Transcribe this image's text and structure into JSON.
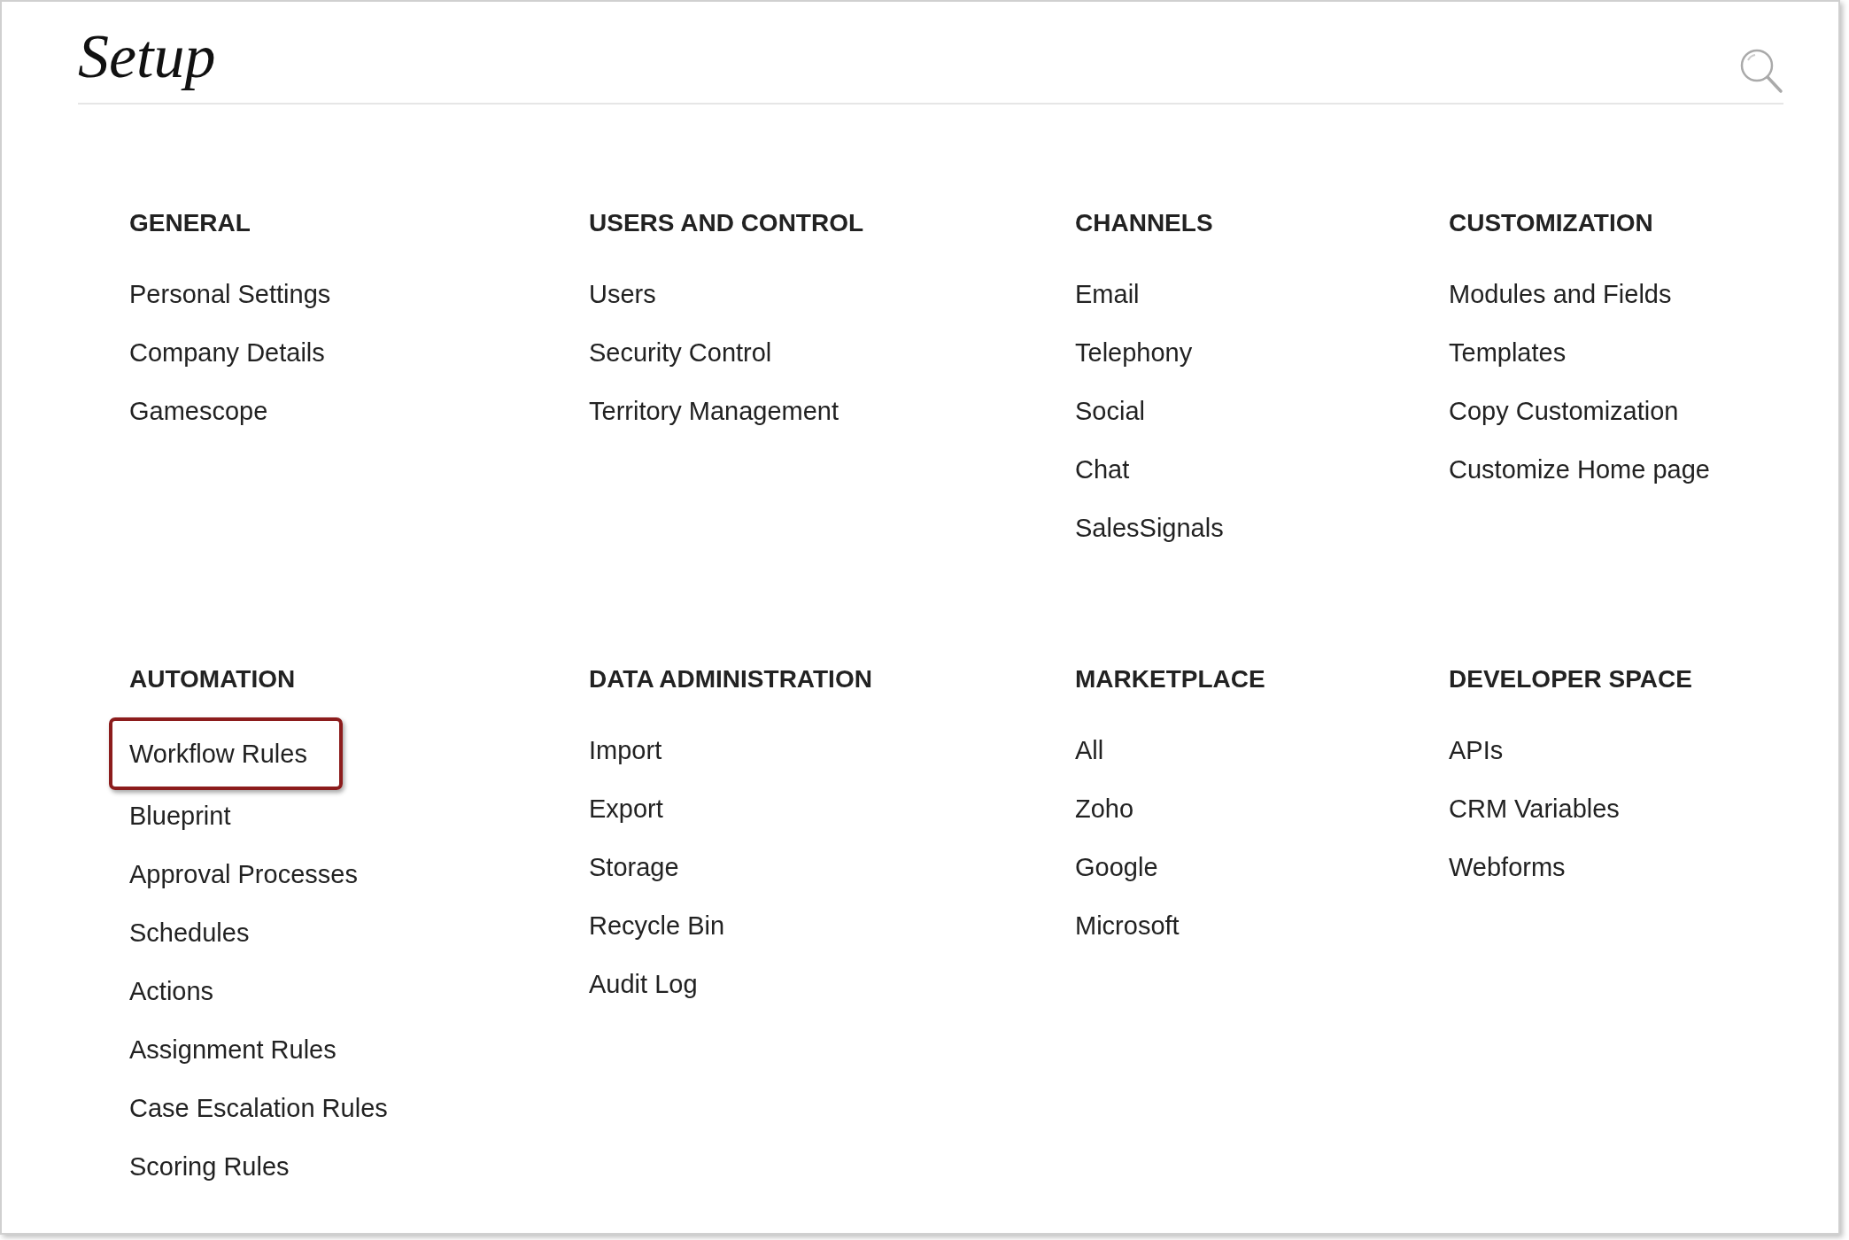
{
  "page": {
    "title": "Setup"
  },
  "sections": [
    {
      "heading": "GENERAL",
      "items": [
        {
          "label": "Personal Settings",
          "highlighted": false
        },
        {
          "label": "Company Details",
          "highlighted": false
        },
        {
          "label": "Gamescope",
          "highlighted": false
        }
      ]
    },
    {
      "heading": "USERS AND CONTROL",
      "items": [
        {
          "label": "Users",
          "highlighted": false
        },
        {
          "label": "Security Control",
          "highlighted": false
        },
        {
          "label": "Territory Management",
          "highlighted": false
        }
      ]
    },
    {
      "heading": "CHANNELS",
      "items": [
        {
          "label": "Email",
          "highlighted": false
        },
        {
          "label": "Telephony",
          "highlighted": false
        },
        {
          "label": "Social",
          "highlighted": false
        },
        {
          "label": "Chat",
          "highlighted": false
        },
        {
          "label": "SalesSignals",
          "highlighted": false
        }
      ]
    },
    {
      "heading": "CUSTOMIZATION",
      "items": [
        {
          "label": "Modules and Fields",
          "highlighted": false
        },
        {
          "label": "Templates",
          "highlighted": false
        },
        {
          "label": "Copy Customization",
          "highlighted": false
        },
        {
          "label": "Customize Home page",
          "highlighted": false
        }
      ]
    },
    {
      "heading": "AUTOMATION",
      "items": [
        {
          "label": "Workflow Rules",
          "highlighted": true
        },
        {
          "label": "Blueprint",
          "highlighted": false
        },
        {
          "label": "Approval Processes",
          "highlighted": false
        },
        {
          "label": "Schedules",
          "highlighted": false
        },
        {
          "label": "Actions",
          "highlighted": false
        },
        {
          "label": "Assignment Rules",
          "highlighted": false
        },
        {
          "label": "Case Escalation Rules",
          "highlighted": false
        },
        {
          "label": "Scoring Rules",
          "highlighted": false
        }
      ]
    },
    {
      "heading": "DATA ADMINISTRATION",
      "items": [
        {
          "label": "Import",
          "highlighted": false
        },
        {
          "label": "Export",
          "highlighted": false
        },
        {
          "label": "Storage",
          "highlighted": false
        },
        {
          "label": "Recycle Bin",
          "highlighted": false
        },
        {
          "label": "Audit Log",
          "highlighted": false
        }
      ]
    },
    {
      "heading": "MARKETPLACE",
      "items": [
        {
          "label": "All",
          "highlighted": false
        },
        {
          "label": "Zoho",
          "highlighted": false
        },
        {
          "label": "Google",
          "highlighted": false
        },
        {
          "label": "Microsoft",
          "highlighted": false
        }
      ]
    },
    {
      "heading": "DEVELOPER SPACE",
      "items": [
        {
          "label": "APIs",
          "highlighted": false
        },
        {
          "label": "CRM Variables",
          "highlighted": false
        },
        {
          "label": "Webforms",
          "highlighted": false
        }
      ]
    }
  ]
}
